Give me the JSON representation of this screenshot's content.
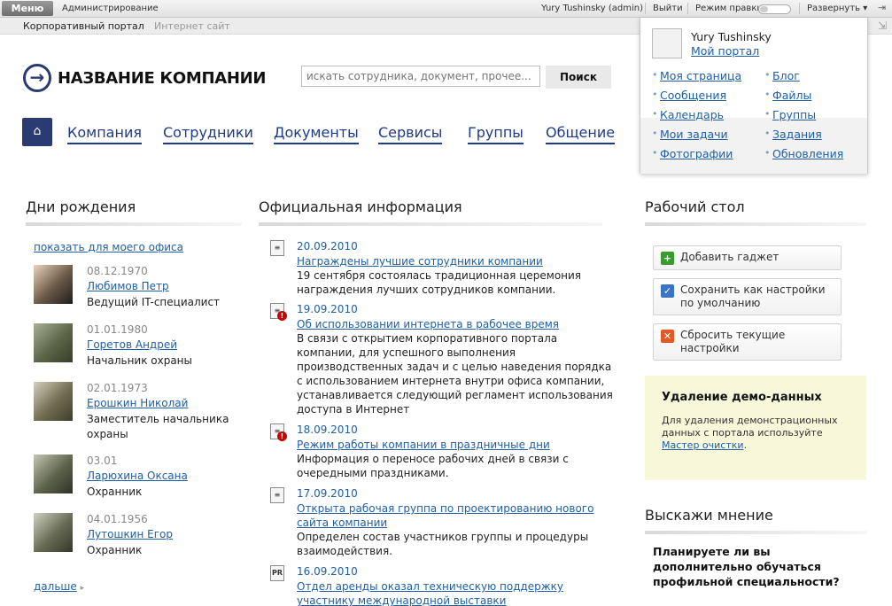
{
  "adminbar": {
    "menu": "Меню",
    "admin": "Администрирование",
    "user": "Yury Tushinsky (admin)",
    "logout": "Выйти",
    "edit_mode": "Режим правки",
    "expand": "Развернуть"
  },
  "sitebar": {
    "portal": "Корпоративный портал",
    "site": "Интернет сайт"
  },
  "header": {
    "company": "НАЗВАНИЕ КОМПАНИИ",
    "search_placeholder": "искать сотрудника, документ, прочее...",
    "search_button": "Поиск"
  },
  "nav": [
    "Компания",
    "Сотрудники",
    "Документы",
    "Сервисы",
    "Группы",
    "Общение"
  ],
  "birthdays": {
    "title": "Дни рождения",
    "show_office": "показать для моего офиса",
    "more": "дальше",
    "people": [
      {
        "date": "08.12.1970",
        "name": "Любимов Петр",
        "role": "Ведущий IT-специалист"
      },
      {
        "date": "01.01.1980",
        "name": "Горетов Андрей",
        "role": "Начальник охраны"
      },
      {
        "date": "02.01.1973",
        "name": "Ерошкин Николай",
        "role": "Заместитель начальника охраны"
      },
      {
        "date": "03.01",
        "name": "Ларюхина Оксана",
        "role": "Охранник"
      },
      {
        "date": "04.01.1956",
        "name": "Лутошкин Егор",
        "role": "Охранник"
      }
    ]
  },
  "news": {
    "title": "Официальная информация",
    "items": [
      {
        "date": "20.09.2010",
        "title": "Награждены лучшие сотрудники компании",
        "text": "19 сентября состоялась традиционная церемония награждения лучших сотрудников компании.",
        "icon": "document-icon"
      },
      {
        "date": "19.09.2010",
        "title": "Об использовании интернета в рабочее время",
        "text": "В связи с открытием корпоративного портала компании, для успешного выполнения производственных задач и с целью наведения порядка с использованием интернета внутри офиса компании, устанавливается следующий регламент использования доступа в Интернет",
        "icon": "important-document-icon"
      },
      {
        "date": "18.09.2010",
        "title": "Режим работы компании в праздничные дни",
        "text": "Информация о переносе рабочих дней в связи с очередными праздниками.",
        "icon": "important-document-icon"
      },
      {
        "date": "17.09.2010",
        "title": "Открыта рабочая группа по проектированию нового сайта компании",
        "text": "Определен состав участников группы и процедуры взаимодействия.",
        "icon": "document-icon"
      },
      {
        "date": "16.09.2010",
        "title": "Отдел аренды оказал техническую поддержку участнику международной выставки",
        "text": "",
        "icon": "pr-document-icon"
      }
    ]
  },
  "desktop": {
    "title": "Рабочий стол",
    "add": "Добавить гаджет",
    "save": "Сохранить как настройки по умолчанию",
    "reset": "Сбросить текущие настройки"
  },
  "demo": {
    "title": "Удаление демо-данных",
    "text": "Для удаления демонстрационных данных с портала используйте",
    "link": "Мастер очистки",
    "end": "."
  },
  "poll": {
    "title": "Выскажи мнение",
    "question": "Планируете ли вы дополнительно обучаться профильной специальности?"
  },
  "userpop": {
    "name": "Yury Tushinsky",
    "portal": "Мой портал",
    "left": [
      "Моя страница",
      "Сообщения",
      "Календарь",
      "Мои задачи",
      "Фотографии"
    ],
    "right": [
      "Блог",
      "Файлы",
      "Группы",
      "Задания",
      "Обновления"
    ]
  },
  "colors": {
    "brand": "#2a3a72",
    "link": "#1f5fa6",
    "demo_bg": "#f8f7d9"
  }
}
